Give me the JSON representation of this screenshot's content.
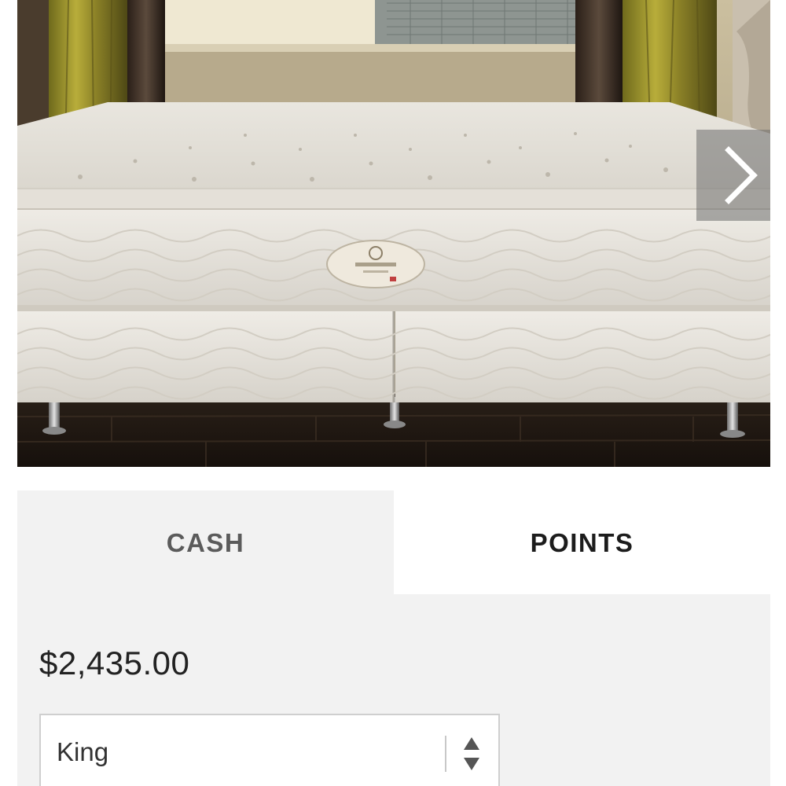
{
  "hero": {
    "image_alt": "Sheraton mattress on box spring in a hotel room",
    "next_icon": "chevron-right-icon"
  },
  "tabs": [
    {
      "id": "cash",
      "label": "CASH"
    },
    {
      "id": "points",
      "label": "POINTS"
    }
  ],
  "product": {
    "price": "$2,435.00",
    "size": {
      "selected": "King",
      "icon": "up-down-arrows-icon"
    }
  },
  "colors": {
    "panel_bg": "#f2f2f2",
    "active_tab_bg": "#ffffff",
    "text_dark": "#1c1c1c",
    "text_muted": "#5b5b5b"
  }
}
